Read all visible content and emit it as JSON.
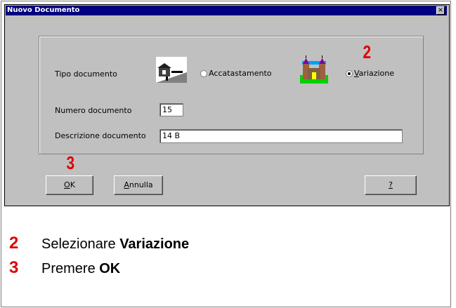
{
  "window": {
    "title": "Nuovo Documento",
    "close_glyph": "×"
  },
  "form": {
    "tipo_label": "Tipo documento",
    "radio_accatastamento": "Accatastamento",
    "radio_variazione": "Variazione",
    "selected_type": "Variazione",
    "numero_label": "Numero documento",
    "numero_value": "15",
    "descrizione_label": "Descrizione documento",
    "descrizione_value": "14 B"
  },
  "buttons": {
    "ok": "OK",
    "annulla": "Annulla",
    "help": "?"
  },
  "markers": {
    "step2": "2",
    "step3": "3"
  },
  "instructions": [
    {
      "num": "2",
      "text": "Selezionare ",
      "bold": "Variazione"
    },
    {
      "num": "3",
      "text": "Premere ",
      "bold": "OK"
    }
  ],
  "icons": [
    "house-icon",
    "castle-icon"
  ],
  "colors": {
    "titlebar": "#000080",
    "marker_red": "#e00000",
    "dialog_bg": "#c0c0c0"
  }
}
